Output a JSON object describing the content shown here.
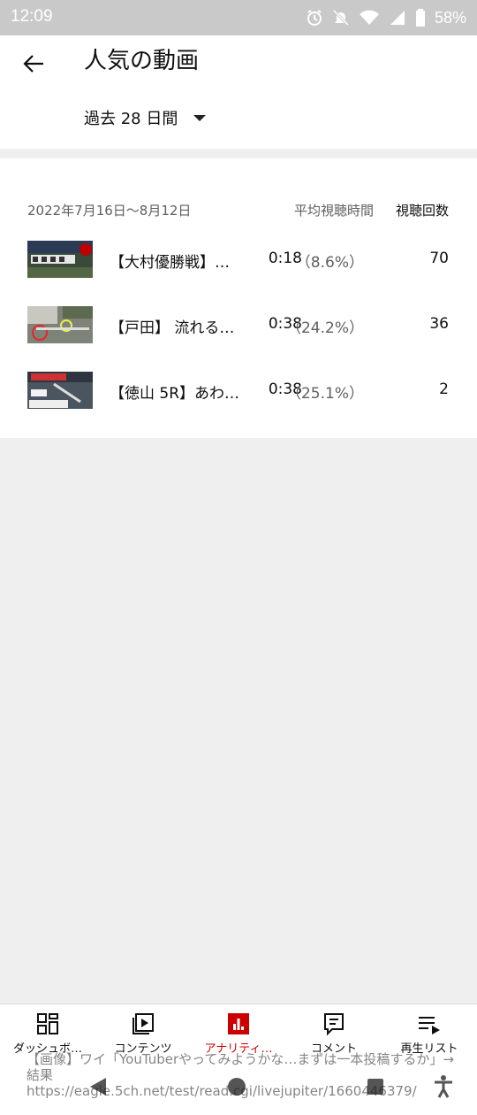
{
  "status": {
    "time": "12:09",
    "battery": "58%"
  },
  "appbar": {
    "title": "人気の動画",
    "period": "過去 28 日間"
  },
  "table": {
    "date_range": "2022年7月16日〜8月12日",
    "col_avg": "平均視聴時間",
    "col_views": "視聴回数",
    "rows": [
      {
        "title": "【大村優勝戦】…",
        "avg": "0:18",
        "pct": "（8.6%）",
        "views": "70"
      },
      {
        "title": "【戸田】 流れる…",
        "avg": "0:38",
        "pct": "（24.2%）",
        "views": "36"
      },
      {
        "title": "【徳山 5R】あわ…",
        "avg": "0:38",
        "pct": "（25.1%）",
        "views": "2"
      }
    ]
  },
  "nav": [
    {
      "label": "ダッシュボ…",
      "icon": "dashboard-icon"
    },
    {
      "label": "コンテンツ",
      "icon": "content-icon"
    },
    {
      "label": "アナリティ…",
      "icon": "analytics-icon",
      "active": true
    },
    {
      "label": "コメント",
      "icon": "comment-icon"
    },
    {
      "label": "再生リスト",
      "icon": "playlist-icon"
    }
  ],
  "overlay": {
    "line1": "【画像】ワイ「YouTuberやってみようかな…まずは一本投稿するか」→",
    "line2": "結果",
    "line3": "https://eagle.5ch.net/test/read.cgi/livejupiter/1660446379/"
  },
  "colors": {
    "accent": "#cc0000",
    "statusbar": "#c9c9c9"
  }
}
